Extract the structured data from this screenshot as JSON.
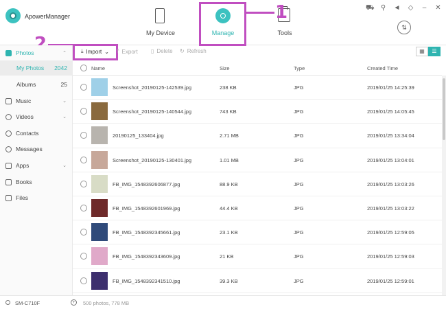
{
  "app": {
    "title": "ApowerManager"
  },
  "nav": [
    {
      "label": "My Device"
    },
    {
      "label": "Manage"
    },
    {
      "label": "Tools"
    }
  ],
  "annotations": {
    "step1": "1",
    "step2": "2"
  },
  "toolbar": {
    "import": "Import",
    "export": "Export",
    "delete": "Delete",
    "refresh": "Refresh"
  },
  "sidebar": {
    "photos": "Photos",
    "my_photos": {
      "label": "My Photos",
      "count": "2042"
    },
    "albums": {
      "label": "Albums",
      "count": "25"
    },
    "music": "Music",
    "videos": "Videos",
    "contacts": "Contacts",
    "messages": "Messages",
    "apps": "Apps",
    "books": "Books",
    "files": "Files"
  },
  "table": {
    "headers": {
      "name": "Name",
      "size": "Size",
      "type": "Type",
      "date": "Created Time"
    },
    "rows": [
      {
        "name": "Screenshot_20190125-142539.jpg",
        "size": "238 KB",
        "type": "JPG",
        "date": "2019/01/25 14:25:39",
        "thumb": "#9fd0e8"
      },
      {
        "name": "Screenshot_20190125-140544.jpg",
        "size": "743 KB",
        "type": "JPG",
        "date": "2019/01/25 14:05:45",
        "thumb": "#8a6a3e"
      },
      {
        "name": "20190125_133404.jpg",
        "size": "2.71 MB",
        "type": "JPG",
        "date": "2019/01/25 13:34:04",
        "thumb": "#b8b4ae"
      },
      {
        "name": "Screenshot_20190125-130401.jpg",
        "size": "1.01 MB",
        "type": "JPG",
        "date": "2019/01/25 13:04:01",
        "thumb": "#c7a89a"
      },
      {
        "name": "FB_IMG_1548392606877.jpg",
        "size": "88.9 KB",
        "type": "JPG",
        "date": "2019/01/25 13:03:26",
        "thumb": "#d8dcc6"
      },
      {
        "name": "FB_IMG_1548392601969.jpg",
        "size": "44.4 KB",
        "type": "JPG",
        "date": "2019/01/25 13:03:22",
        "thumb": "#6e2a2a"
      },
      {
        "name": "FB_IMG_1548392345661.jpg",
        "size": "23.1 KB",
        "type": "JPG",
        "date": "2019/01/25 12:59:05",
        "thumb": "#2f4a7a"
      },
      {
        "name": "FB_IMG_1548392343609.jpg",
        "size": "21 KB",
        "type": "JPG",
        "date": "2019/01/25 12:59:03",
        "thumb": "#e0a9c9"
      },
      {
        "name": "FB_IMG_1548392341510.jpg",
        "size": "39.3 KB",
        "type": "JPG",
        "date": "2019/01/25 12:59:01",
        "thumb": "#3d2f6e"
      }
    ]
  },
  "status": {
    "device": "SM-C710F",
    "info": "500 photos, 778 MB"
  },
  "colors": {
    "accent": "#2eb4b0",
    "annotation": "#c04ec0"
  }
}
